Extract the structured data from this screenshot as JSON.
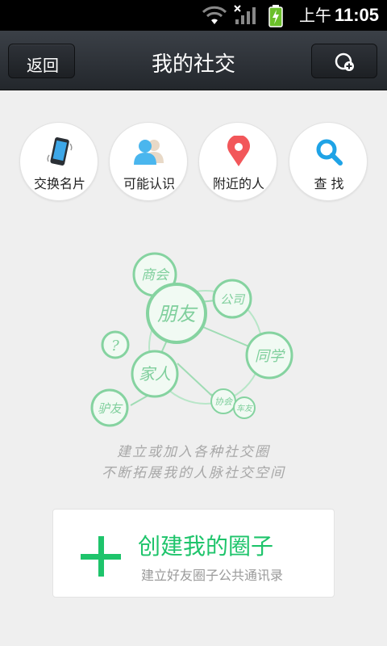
{
  "status_bar": {
    "ampm": "上午",
    "time": "11:05",
    "icons": [
      "wifi-icon",
      "signal-icon",
      "battery-charging-icon"
    ]
  },
  "header": {
    "back_label": "返回",
    "title": "我的社交",
    "add_icon": "add-circle-icon"
  },
  "shortcuts": [
    {
      "label": "交换名片",
      "icon": "phone-shake-icon"
    },
    {
      "label": "可能认识",
      "icon": "people-icon"
    },
    {
      "label": "附近的人",
      "icon": "location-pin-icon"
    },
    {
      "label": "查 找",
      "icon": "search-icon"
    }
  ],
  "illustration": {
    "bubbles": [
      "商会",
      "朋友",
      "公司",
      "?",
      "家人",
      "同学",
      "驴友",
      "协会",
      "车友"
    ]
  },
  "description": {
    "line1": "建立或加入各种社交圈",
    "line2": "不断拓展我的人脉社交空间"
  },
  "create_card": {
    "title": "创建我的圈子",
    "subtitle": "建立好友圈子公共通讯录"
  },
  "colors": {
    "accent_green": "#1ec46b",
    "titlebar_dark": "#2b2f34",
    "pin_red": "#f2575a",
    "search_blue": "#1fa3e6"
  }
}
